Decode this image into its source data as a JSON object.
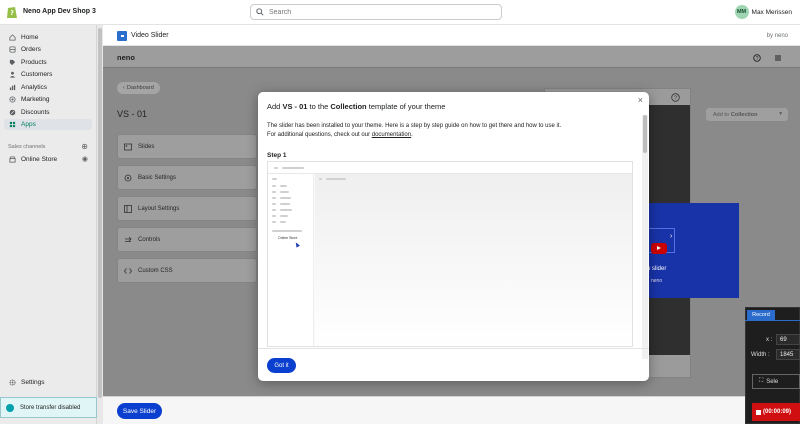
{
  "topbar": {
    "shop_name": "Neno App Dev Shop 3",
    "search_placeholder": "Search",
    "user_initials": "MM",
    "user_name": "Max Merissen"
  },
  "sidebar": {
    "items": [
      {
        "label": "Home",
        "icon": "home-icon"
      },
      {
        "label": "Orders",
        "icon": "orders-icon"
      },
      {
        "label": "Products",
        "icon": "tag-icon"
      },
      {
        "label": "Customers",
        "icon": "person-icon"
      },
      {
        "label": "Analytics",
        "icon": "chart-icon"
      },
      {
        "label": "Marketing",
        "icon": "target-icon"
      },
      {
        "label": "Discounts",
        "icon": "discount-icon"
      },
      {
        "label": "Apps",
        "icon": "apps-icon",
        "active": true
      }
    ],
    "sales_channels_label": "Sales channels",
    "online_store_label": "Online Store",
    "settings_label": "Settings",
    "store_transfer_label": "Store transfer disabled"
  },
  "app_header": {
    "title": "Video Slider",
    "by": "by neno"
  },
  "app": {
    "logo": "neno",
    "dashboard_btn": "Dashboard",
    "page_title": "VS - 01",
    "add_to": "Add to",
    "collection": "Collection",
    "menu": [
      "Slides",
      "Basic Settings",
      "Layout Settings",
      "Controls",
      "Custom CSS"
    ],
    "save_button": "Save Slider",
    "preview_slider_text": "o slider",
    "preview_neno": "neno"
  },
  "modal": {
    "title_prefix": "Add ",
    "title_slider": "VS - 01",
    "title_mid": " to the ",
    "title_collection": "Collection",
    "title_suffix": " template of your theme",
    "body_line1": "The slider has been installed to your theme. Here is a step by step guide on how to get there and how to use it.",
    "body_line2_prefix": "For additional questions, check out our ",
    "body_link": "documentation",
    "body_line2_suffix": ".",
    "step_label": "Step 1",
    "shot_online_store": "Online Store",
    "got_it": "Got it",
    "close": "×"
  },
  "record": {
    "tab": "Record",
    "x_label": "x :",
    "x_value": "69",
    "width_label": "Width :",
    "width_value": "1845",
    "select_label": "Sele",
    "record_btn": "(00:00:09)"
  },
  "colors": {
    "accent": "#0b3fcf",
    "active_nav": "#008060",
    "slide_blue": "#1833a8"
  }
}
